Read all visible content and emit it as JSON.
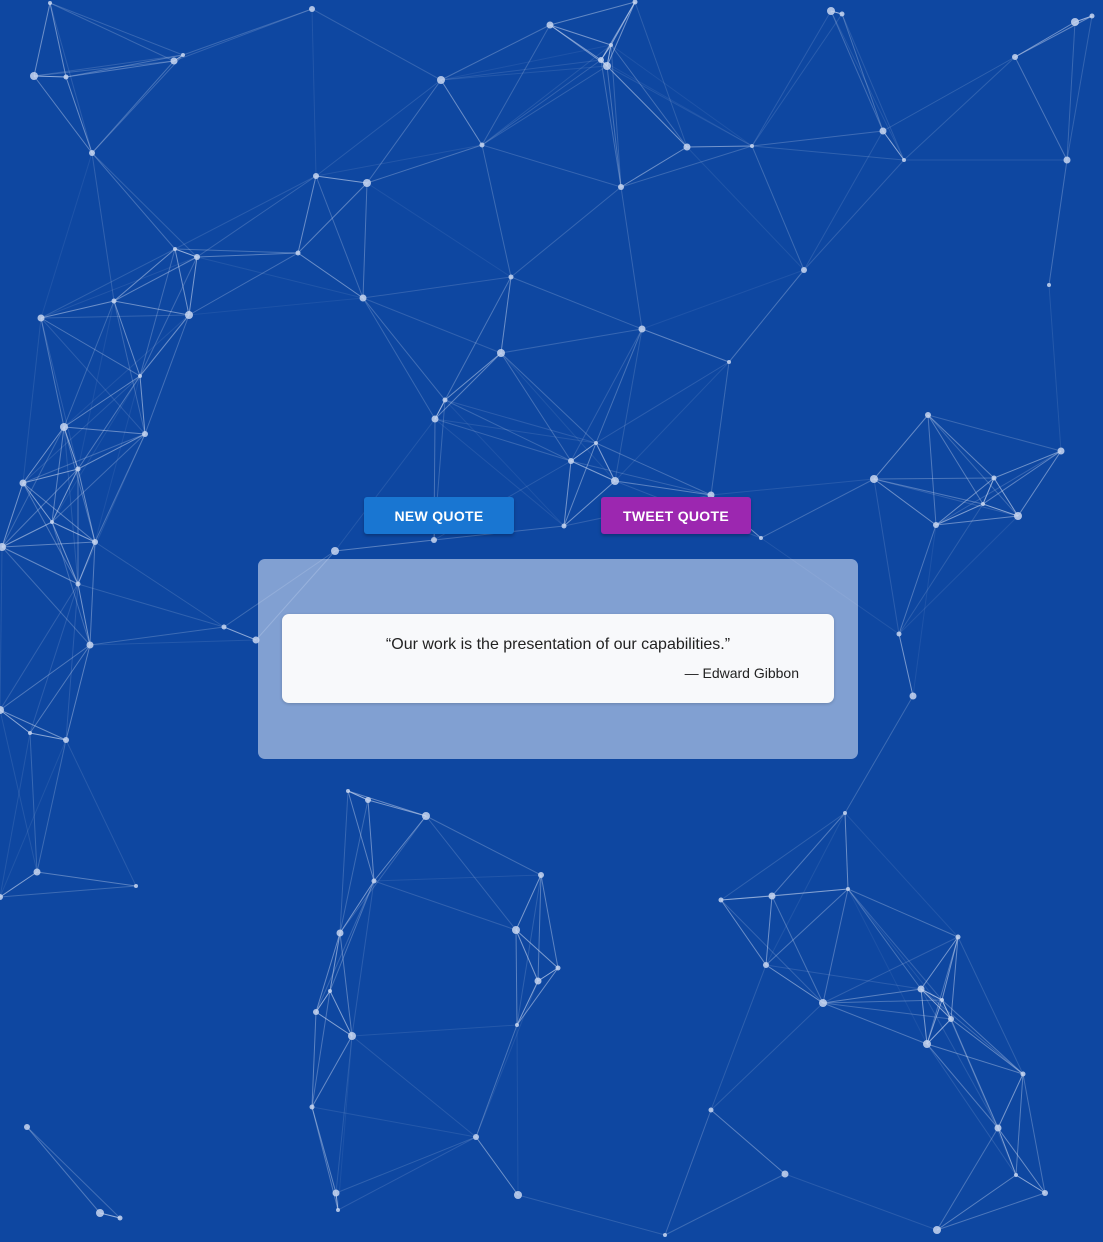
{
  "colors": {
    "background": "#0e47a1",
    "network": "#c8d6f0",
    "new_quote_button": "#1976d2",
    "tweet_quote_button": "#9c27b0"
  },
  "buttons": {
    "new_quote_label": "NEW QUOTE",
    "tweet_quote_label": "TWEET QUOTE"
  },
  "quote": {
    "text": "“Our work is the presentation of our capabilities.”",
    "author": "— Edward Gibbon"
  }
}
